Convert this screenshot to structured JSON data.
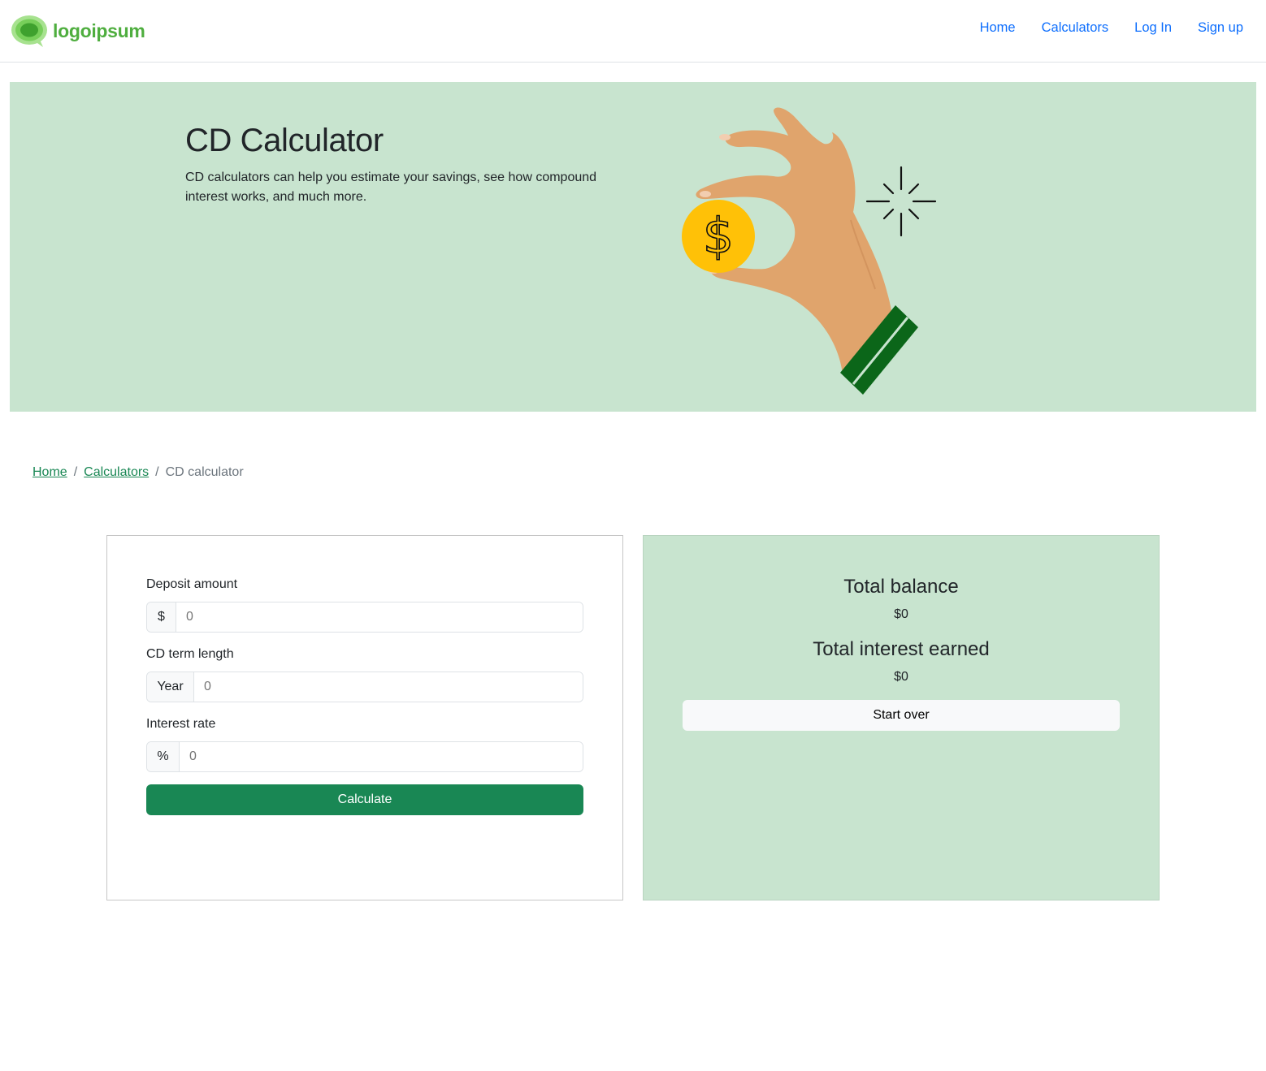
{
  "header": {
    "brand": "logoipsum",
    "nav": [
      {
        "label": "Home"
      },
      {
        "label": "Calculators"
      },
      {
        "label": "Log In"
      },
      {
        "label": "Sign up"
      }
    ]
  },
  "hero": {
    "title": "CD Calculator",
    "description": "CD calculators can help you estimate your savings, see how compound interest works, and much more.",
    "illustration": {
      "icon": "hand-holding-coin-icon",
      "coin_symbol": "$",
      "coin_color": "#ffc107",
      "cuff_color": "#0b6619",
      "sparkle_icon": "sparkle-icon"
    },
    "background": "#c8e4cf"
  },
  "breadcrumb": {
    "items": [
      {
        "label": "Home",
        "link": true
      },
      {
        "label": "Calculators",
        "link": true
      },
      {
        "label": "CD calculator",
        "link": false
      }
    ],
    "separator": "/"
  },
  "form": {
    "deposit": {
      "label": "Deposit amount",
      "addon": "$",
      "placeholder": "0"
    },
    "term": {
      "label": "CD term length",
      "addon": "Year",
      "placeholder": "0"
    },
    "rate": {
      "label": "Interest rate",
      "addon": "%",
      "placeholder": "0"
    },
    "calculate_label": "Calculate"
  },
  "results": {
    "balance_label": "Total balance",
    "balance_value": "$0",
    "interest_label": "Total interest earned",
    "interest_value": "$0",
    "start_over_label": "Start over"
  },
  "colors": {
    "primary_link": "#0d6efd",
    "success": "#198754",
    "brand_green": "#4fae3f",
    "hero_bg": "#c8e4cf"
  }
}
